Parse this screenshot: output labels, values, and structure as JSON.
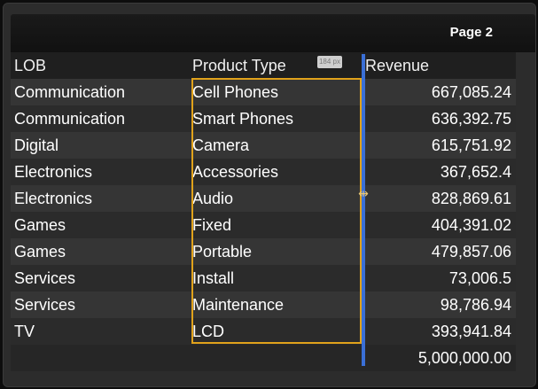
{
  "header": {
    "page_label": "Page 2"
  },
  "columns": {
    "lob": "LOB",
    "product_type": "Product Type",
    "revenue": "Revenue",
    "width_badge": "184 px"
  },
  "rows": [
    {
      "lob": "Communication",
      "product_type": "Cell Phones",
      "revenue": "667,085.24"
    },
    {
      "lob": "Communication",
      "product_type": "Smart Phones",
      "revenue": "636,392.75"
    },
    {
      "lob": "Digital",
      "product_type": "Camera",
      "revenue": "615,751.92"
    },
    {
      "lob": "Electronics",
      "product_type": "Accessories",
      "revenue": "367,652.4"
    },
    {
      "lob": "Electronics",
      "product_type": "Audio",
      "revenue": "828,869.61"
    },
    {
      "lob": "Games",
      "product_type": "Fixed",
      "revenue": "404,391.02"
    },
    {
      "lob": "Games",
      "product_type": "Portable",
      "revenue": "479,857.06"
    },
    {
      "lob": "Services",
      "product_type": "Install",
      "revenue": "73,006.5"
    },
    {
      "lob": "Services",
      "product_type": "Maintenance",
      "revenue": "98,786.94"
    },
    {
      "lob": "TV",
      "product_type": "LCD",
      "revenue": "393,941.84"
    }
  ],
  "total": {
    "revenue": "5,000,000.00"
  },
  "colors": {
    "selection_border": "#e1a21b",
    "resize_handle": "#3a6fd6"
  },
  "icons": {
    "resize_cursor": "resize-horizontal-icon"
  }
}
